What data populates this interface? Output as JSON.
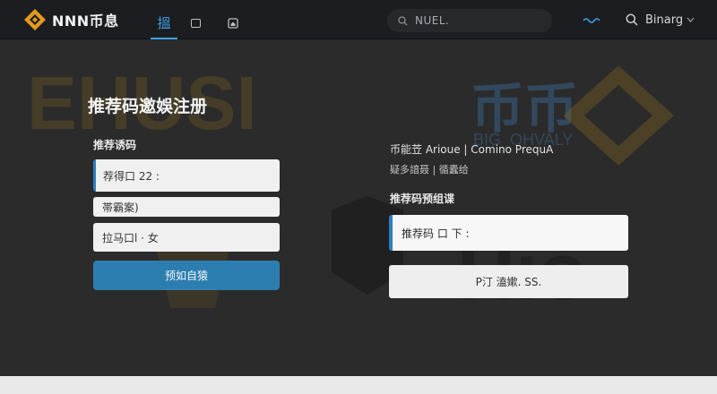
{
  "header": {
    "brand_name": "NNN币息",
    "active_tab_label": "搵",
    "search_label": "NUEL.",
    "user_name": "Binarg"
  },
  "colors": {
    "accent": "#2f7fc0",
    "brand_orange": "#e39a1f",
    "topbar": "#1c1d20",
    "page_bg": "#2b2b2b"
  },
  "watermark_text": {
    "left": "EHUSI",
    "right": "币币",
    "right_sub": "BIG_OHVALY",
    "bottom": "Hio"
  },
  "form": {
    "title": "推荐码邀娛注册",
    "section_label": "推荐诱码",
    "field1_value": "荐得口 22 :",
    "field2_value": "帯霸案)",
    "field3_value": "拉马口l · 女",
    "submit_label": "预如自猿"
  },
  "info": {
    "line1": "币能苙 Arioue | Comino PrequA",
    "line2": "疑多諳聂 | 循蠹给",
    "code_section_label": "推荐码预组谍",
    "code_value": "推荐码 口 下 :",
    "copy_label": "P汀 溘嫰.  SS."
  }
}
